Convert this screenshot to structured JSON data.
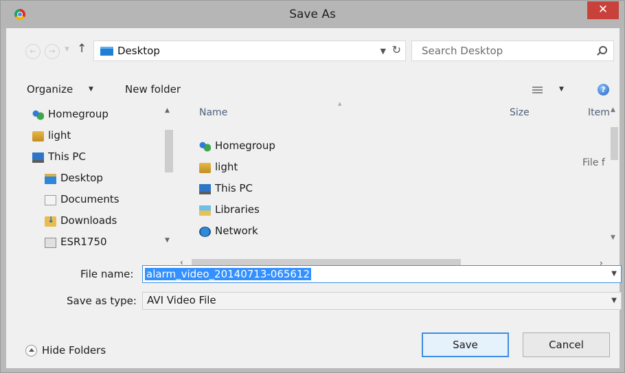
{
  "window": {
    "title": "Save As",
    "close_glyph": "✕"
  },
  "nav": {
    "back_glyph": "←",
    "forward_glyph": "→",
    "up_glyph": "↑",
    "address": "Desktop",
    "refresh_glyph": "↻",
    "search_placeholder": "Search Desktop"
  },
  "toolbar": {
    "organize_label": "Organize",
    "new_folder_label": "New folder",
    "help_glyph": "?"
  },
  "nav_pane": {
    "items": [
      {
        "label": "Homegroup",
        "icon": "homegroup-icon"
      },
      {
        "label": "light",
        "icon": "user-folder-icon"
      },
      {
        "label": "This PC",
        "icon": "computer-icon"
      },
      {
        "label": "Desktop",
        "icon": "desktop-folder-icon"
      },
      {
        "label": "Documents",
        "icon": "documents-icon"
      },
      {
        "label": "Downloads",
        "icon": "downloads-icon"
      },
      {
        "label": "ESR1750",
        "icon": "network-device-icon"
      }
    ]
  },
  "file_list": {
    "columns": [
      "Name",
      "Size",
      "Item"
    ],
    "items": [
      {
        "label": "Homegroup",
        "icon": "homegroup-icon",
        "type": ""
      },
      {
        "label": "light",
        "icon": "user-folder-icon",
        "type": "File f"
      },
      {
        "label": "This PC",
        "icon": "computer-icon",
        "type": ""
      },
      {
        "label": "Libraries",
        "icon": "libraries-icon",
        "type": ""
      },
      {
        "label": "Network",
        "icon": "network-icon",
        "type": ""
      }
    ]
  },
  "form": {
    "file_name_label": "File name:",
    "file_name_value": "alarm_video_20140713-065612",
    "save_type_label": "Save as type:",
    "save_type_value": "AVI Video File"
  },
  "footer": {
    "hide_folders_label": "Hide Folders",
    "save_label": "Save",
    "cancel_label": "Cancel"
  },
  "colors": {
    "accent": "#3390ff",
    "close": "#c8413a",
    "titlebar": "#b6b6b6"
  }
}
